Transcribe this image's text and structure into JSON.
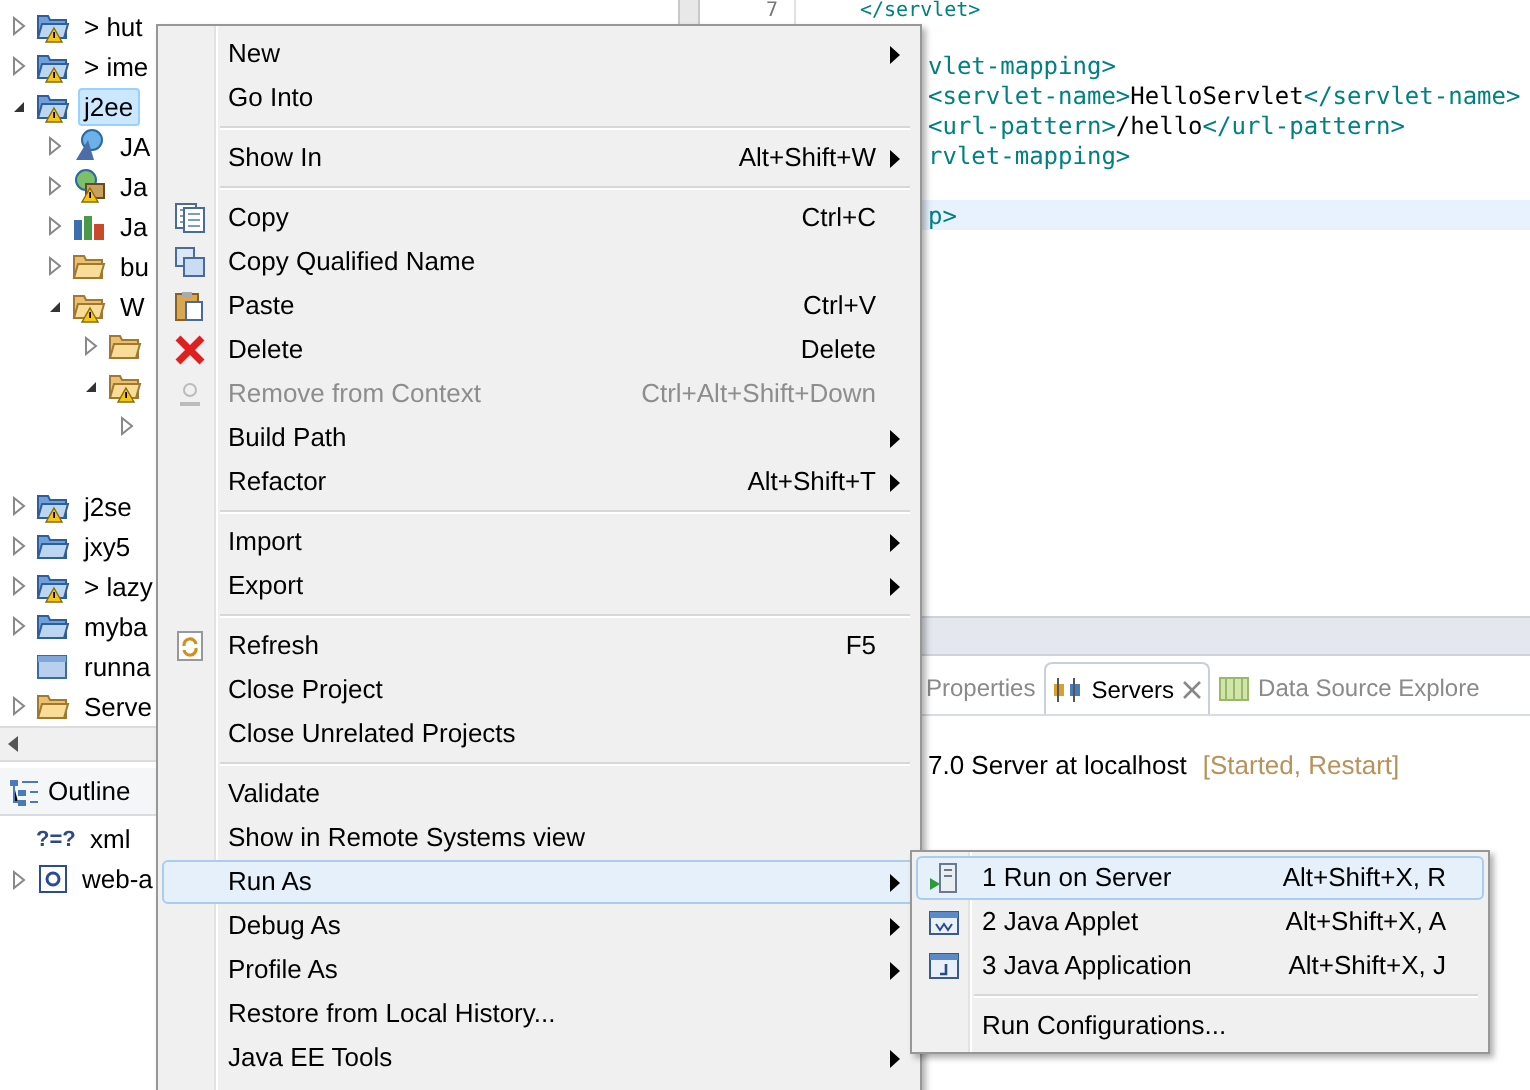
{
  "explorer": {
    "items": [
      {
        "label": "> hut",
        "kind": "project",
        "warning": true,
        "selected": false,
        "expanded": false
      },
      {
        "label": "> ime",
        "kind": "project",
        "warning": true,
        "selected": false,
        "expanded": false
      },
      {
        "label": "j2ee",
        "kind": "project",
        "warning": true,
        "selected": true,
        "expanded": true,
        "children": [
          {
            "label": "JA",
            "kind": "jaxws",
            "warning": false,
            "selected": false,
            "expanded": false
          },
          {
            "label": "Ja",
            "kind": "javaee",
            "warning": true,
            "selected": false,
            "expanded": false
          },
          {
            "label": "Ja",
            "kind": "library",
            "warning": false,
            "selected": false,
            "expanded": false
          },
          {
            "label": "bu",
            "kind": "folder",
            "warning": false,
            "selected": false,
            "expanded": false
          },
          {
            "label": "W",
            "kind": "folder",
            "warning": true,
            "selected": false,
            "expanded": true,
            "children": [
              {
                "kind": "folder",
                "warning": false,
                "expanded": false
              },
              {
                "kind": "folder",
                "warning": true,
                "expanded": true,
                "children": [
                  {
                    "expanded": false
                  }
                ]
              }
            ]
          }
        ]
      },
      {
        "kind": "gap"
      },
      {
        "label": "j2se",
        "kind": "project",
        "warning": true,
        "selected": false,
        "expanded": false
      },
      {
        "label": "jxy5",
        "kind": "project",
        "warning": false,
        "selected": false,
        "expanded": false
      },
      {
        "label": "> lazy",
        "kind": "project",
        "warning": true,
        "selected": false,
        "expanded": false
      },
      {
        "label": "myba",
        "kind": "project",
        "warning": false,
        "selected": false,
        "expanded": false
      },
      {
        "label": "runna",
        "kind": "closed-project",
        "warning": false,
        "selected": false
      },
      {
        "label": "Serve",
        "kind": "folder",
        "warning": false,
        "selected": false,
        "expanded": false
      }
    ]
  },
  "outline": {
    "title": "Outline",
    "items": [
      {
        "label": "xml",
        "kind": "xml",
        "glyph": "?=?"
      },
      {
        "label": "web-a",
        "kind": "element",
        "expanded": false
      }
    ]
  },
  "editor": {
    "first_line": {
      "number": "7",
      "segments": [
        {
          "kind": "tag",
          "text": "</servlet>"
        }
      ]
    },
    "lines": [
      {
        "segments": [
          {
            "kind": "tag",
            "text": "vlet-mapping>"
          }
        ],
        "current": false
      },
      {
        "segments": [
          {
            "kind": "tag",
            "text": "<servlet-name>"
          },
          {
            "kind": "text",
            "text": "HelloServlet"
          },
          {
            "kind": "tag",
            "text": "</servlet-name>"
          }
        ],
        "current": false
      },
      {
        "segments": [
          {
            "kind": "tag",
            "text": "<url-pattern>"
          },
          {
            "kind": "text",
            "text": "/hello"
          },
          {
            "kind": "tag",
            "text": "</url-pattern>"
          }
        ],
        "current": false
      },
      {
        "segments": [
          {
            "kind": "tag",
            "text": "rvlet-mapping>"
          }
        ],
        "current": false
      },
      {
        "current": false
      },
      {
        "segments": [
          {
            "kind": "tag",
            "text": "p>"
          }
        ],
        "current": true
      }
    ]
  },
  "panel": {
    "tabs": [
      {
        "label": "Properties",
        "kind": "properties",
        "selected": false
      },
      {
        "label": "Servers",
        "kind": "servers",
        "selected": true
      },
      {
        "label": "Data Source Explore",
        "kind": "datasource",
        "selected": false
      }
    ],
    "server": {
      "name": "7.0 Server at localhost",
      "status": "[Started, Restart]"
    }
  },
  "menu": {
    "items": [
      {
        "kind": "plain",
        "label": "New",
        "submenu": true,
        "selected": false,
        "disabled": false
      },
      {
        "kind": "plain",
        "label": "Go Into",
        "submenu": false,
        "selected": false,
        "disabled": false
      },
      {
        "kind": "separator"
      },
      {
        "kind": "plain",
        "label": "Show In",
        "shortcut": "Alt+Shift+W",
        "submenu": true,
        "selected": false,
        "disabled": false
      },
      {
        "kind": "separator"
      },
      {
        "kind": "copy",
        "label": "Copy",
        "shortcut": "Ctrl+C",
        "submenu": false,
        "selected": false,
        "disabled": false
      },
      {
        "kind": "copy-qualified",
        "label": "Copy Qualified Name",
        "submenu": false,
        "selected": false,
        "disabled": false
      },
      {
        "kind": "paste",
        "label": "Paste",
        "shortcut": "Ctrl+V",
        "submenu": false,
        "selected": false,
        "disabled": false
      },
      {
        "kind": "delete",
        "label": "Delete",
        "shortcut": "Delete",
        "submenu": false,
        "selected": false,
        "disabled": false
      },
      {
        "kind": "remove",
        "label": "Remove from Context",
        "shortcut": "Ctrl+Alt+Shift+Down",
        "submenu": false,
        "selected": false,
        "disabled": true
      },
      {
        "kind": "plain",
        "label": "Build Path",
        "submenu": true,
        "selected": false,
        "disabled": false
      },
      {
        "kind": "plain",
        "label": "Refactor",
        "shortcut": "Alt+Shift+T",
        "submenu": true,
        "selected": false,
        "disabled": false
      },
      {
        "kind": "separator"
      },
      {
        "kind": "plain",
        "label": "Import",
        "submenu": true,
        "selected": false,
        "disabled": false
      },
      {
        "kind": "plain",
        "label": "Export",
        "submenu": true,
        "selected": false,
        "disabled": false
      },
      {
        "kind": "separator"
      },
      {
        "kind": "refresh",
        "label": "Refresh",
        "shortcut": "F5",
        "submenu": false,
        "selected": false,
        "disabled": false
      },
      {
        "kind": "plain",
        "label": "Close Project",
        "submenu": false,
        "selected": false,
        "disabled": false
      },
      {
        "kind": "plain",
        "label": "Close Unrelated Projects",
        "submenu": false,
        "selected": false,
        "disabled": false
      },
      {
        "kind": "separator"
      },
      {
        "kind": "plain",
        "label": "Validate",
        "submenu": false,
        "selected": false,
        "disabled": false
      },
      {
        "kind": "plain",
        "label": "Show in Remote Systems view",
        "submenu": false,
        "selected": false,
        "disabled": false
      },
      {
        "kind": "plain",
        "label": "Run As",
        "submenu": true,
        "selected": true,
        "disabled": false
      },
      {
        "kind": "plain",
        "label": "Debug As",
        "submenu": true,
        "selected": false,
        "disabled": false
      },
      {
        "kind": "plain",
        "label": "Profile As",
        "submenu": true,
        "selected": false,
        "disabled": false
      },
      {
        "kind": "plain",
        "label": "Restore from Local History...",
        "submenu": false,
        "selected": false,
        "disabled": false
      },
      {
        "kind": "plain",
        "label": "Java EE Tools",
        "submenu": true,
        "selected": false,
        "disabled": false
      }
    ]
  },
  "submenu": {
    "items": [
      {
        "kind": "server",
        "label": "1 Run on Server",
        "shortcut": "Alt+Shift+X, R",
        "selected": true
      },
      {
        "kind": "applet",
        "label": "2 Java Applet",
        "shortcut": "Alt+Shift+X, A",
        "selected": false
      },
      {
        "kind": "application",
        "label": "3 Java Application",
        "shortcut": "Alt+Shift+X, J",
        "selected": false
      },
      {
        "kind": "separator"
      },
      {
        "kind": "plain",
        "label": "Run Configurations...",
        "selected": false
      }
    ]
  }
}
